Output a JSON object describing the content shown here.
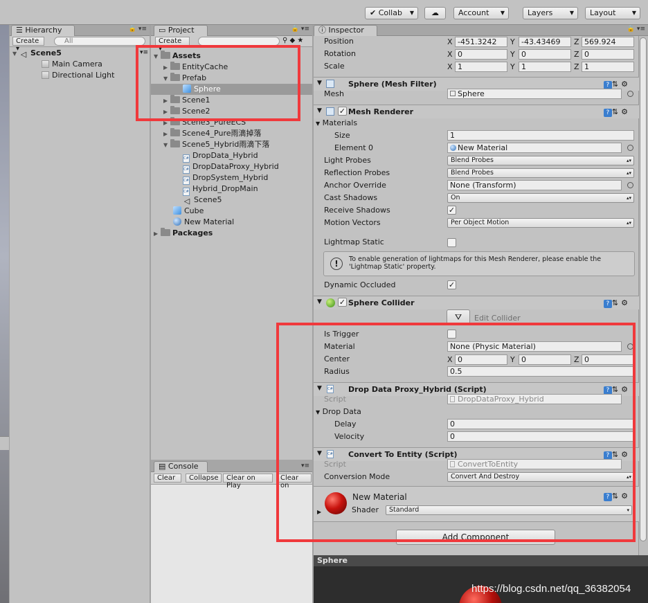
{
  "toolbar": {
    "collab": "Collab",
    "account": "Account",
    "layers": "Layers",
    "layout": "Layout"
  },
  "hierarchy": {
    "tab": "Hierarchy",
    "create": "Create",
    "search_placeholder": "All",
    "scene": "Scene5",
    "items": [
      "Main Camera",
      "Directional Light"
    ]
  },
  "project": {
    "tab": "Project",
    "create": "Create",
    "assets": "Assets",
    "tree": {
      "entity_cache": "EntityCache",
      "prefab": "Prefab",
      "sphere": "Sphere",
      "scene1": "Scene1",
      "scene2": "Scene2",
      "scene3": "Scene3_PureECS",
      "scene4": "Scene4_Pure雨滴掉落",
      "scene5": "Scene5_Hybrid雨滴下落",
      "s5_children": [
        "DropData_Hybrid",
        "DropDataProxy_Hybrid",
        "DropSystem_Hybrid",
        "Hybrid_DropMain",
        "Scene5"
      ],
      "cube": "Cube",
      "new_material": "New Material",
      "packages": "Packages"
    }
  },
  "console": {
    "tab": "Console",
    "buttons": [
      "Clear",
      "Collapse",
      "Clear on Play",
      "Clear on"
    ]
  },
  "inspector": {
    "tab": "Inspector",
    "transform": {
      "position_label": "Position",
      "position": [
        "-451.3242",
        "-43.43469",
        "569.924"
      ],
      "rotation_label": "Rotation",
      "rotation": [
        "0",
        "0",
        "0"
      ],
      "scale_label": "Scale",
      "scale": [
        "1",
        "1",
        "1"
      ],
      "axes": [
        "X",
        "Y",
        "Z"
      ]
    },
    "mesh_filter": {
      "title": "Sphere (Mesh Filter)",
      "mesh_label": "Mesh",
      "mesh_value": "Sphere"
    },
    "mesh_renderer": {
      "title": "Mesh Renderer",
      "materials_label": "Materials",
      "size_label": "Size",
      "size_value": "1",
      "element0_label": "Element 0",
      "element0_value": "New Material",
      "light_probes_label": "Light Probes",
      "light_probes_value": "Blend Probes",
      "reflection_probes_label": "Reflection Probes",
      "reflection_probes_value": "Blend Probes",
      "anchor_label": "Anchor Override",
      "anchor_value": "None (Transform)",
      "cast_label": "Cast Shadows",
      "cast_value": "On",
      "receive_label": "Receive Shadows",
      "motion_label": "Motion Vectors",
      "motion_value": "Per Object Motion",
      "lightmap_label": "Lightmap Static",
      "info": "To enable generation of lightmaps for this Mesh Renderer, please enable the 'Lightmap Static' property.",
      "dynamic_label": "Dynamic Occluded"
    },
    "sphere_collider": {
      "title": "Sphere Collider",
      "edit_label": "Edit Collider",
      "trigger_label": "Is Trigger",
      "material_label": "Material",
      "material_value": "None (Physic Material)",
      "center_label": "Center",
      "center": [
        "0",
        "0",
        "0"
      ],
      "radius_label": "Radius",
      "radius_value": "0.5"
    },
    "drop_proxy": {
      "title": "Drop Data Proxy_Hybrid (Script)",
      "script_label": "Script",
      "script_value": "DropDataProxy_Hybrid",
      "drop_data_label": "Drop Data",
      "delay_label": "Delay",
      "delay_value": "0",
      "velocity_label": "Velocity",
      "velocity_value": "0"
    },
    "convert": {
      "title": "Convert To Entity (Script)",
      "script_label": "Script",
      "script_value": "ConvertToEntity",
      "mode_label": "Conversion Mode",
      "mode_value": "Convert And Destroy"
    },
    "material": {
      "name": "New Material",
      "shader_label": "Shader",
      "shader_value": "Standard"
    },
    "add_component": "Add Component",
    "preview_title": "Sphere"
  },
  "watermark": "https://blog.csdn.net/qq_36382054",
  "colors": {
    "highlight": "#f0393c",
    "selection": "#9a9a9a"
  }
}
